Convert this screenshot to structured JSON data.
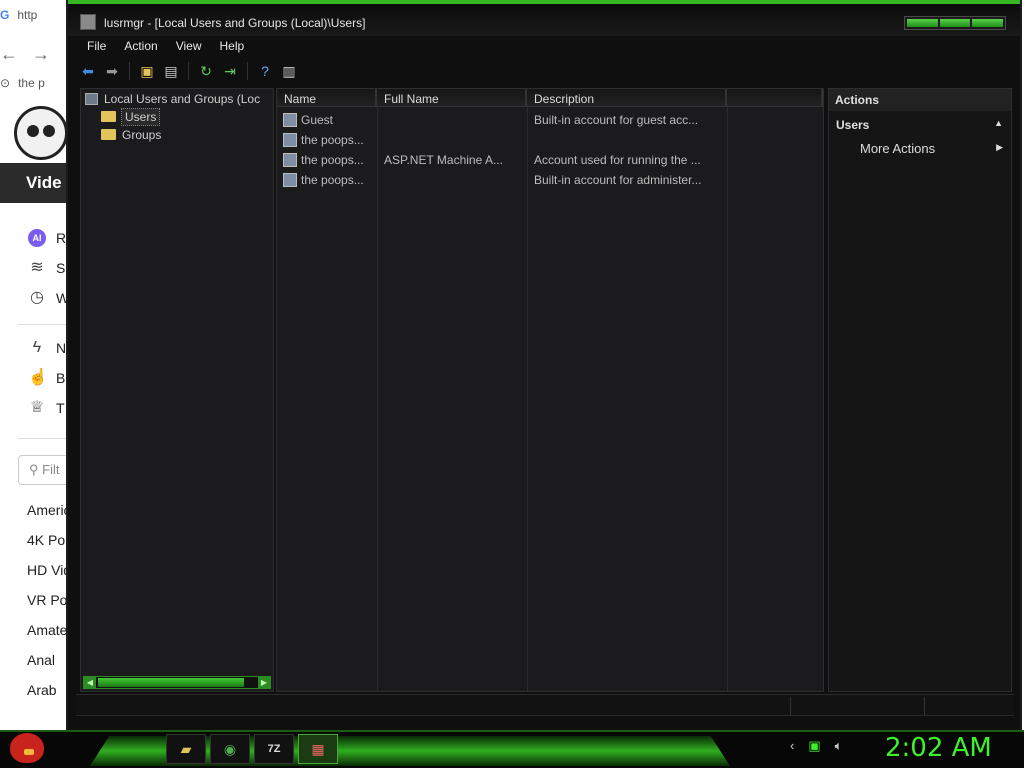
{
  "background_browser": {
    "tab_text": "http",
    "address_text": "the p",
    "section_label": "Vide",
    "sidebar_top": [
      "R",
      "S",
      "W"
    ],
    "sidebar_mid": [
      "N",
      "B",
      "T"
    ],
    "search_placeholder": "Filt",
    "categories": [
      "Americ",
      "4K Po",
      "HD Vid",
      "VR Po",
      "Amate",
      "Anal",
      "Arab"
    ]
  },
  "window": {
    "title": "lusrmgr - [Local Users and Groups (Local)\\Users]",
    "menu": [
      "File",
      "Action",
      "View",
      "Help"
    ]
  },
  "tree": {
    "root": "Local Users and Groups (Loc",
    "children": [
      "Users",
      "Groups"
    ],
    "selected": "Users"
  },
  "list": {
    "columns": [
      "Name",
      "Full Name",
      "Description",
      ""
    ],
    "rows": [
      {
        "name": "Guest",
        "full_name": "",
        "description": "Built-in account for guest acc..."
      },
      {
        "name": "the poops...",
        "full_name": "",
        "description": ""
      },
      {
        "name": "the poops...",
        "full_name": "ASP.NET Machine A...",
        "description": "Account used for running the ..."
      },
      {
        "name": "the poops...",
        "full_name": "",
        "description": "Built-in account for administer..."
      }
    ]
  },
  "actions": {
    "header": "Actions",
    "section": "Users",
    "item": "More Actions"
  },
  "taskbar": {
    "buttons": [
      "folder-icon",
      "chrome-icon",
      "7z-icon",
      "lusrmgr-icon"
    ],
    "clock": "2:02 AM"
  }
}
